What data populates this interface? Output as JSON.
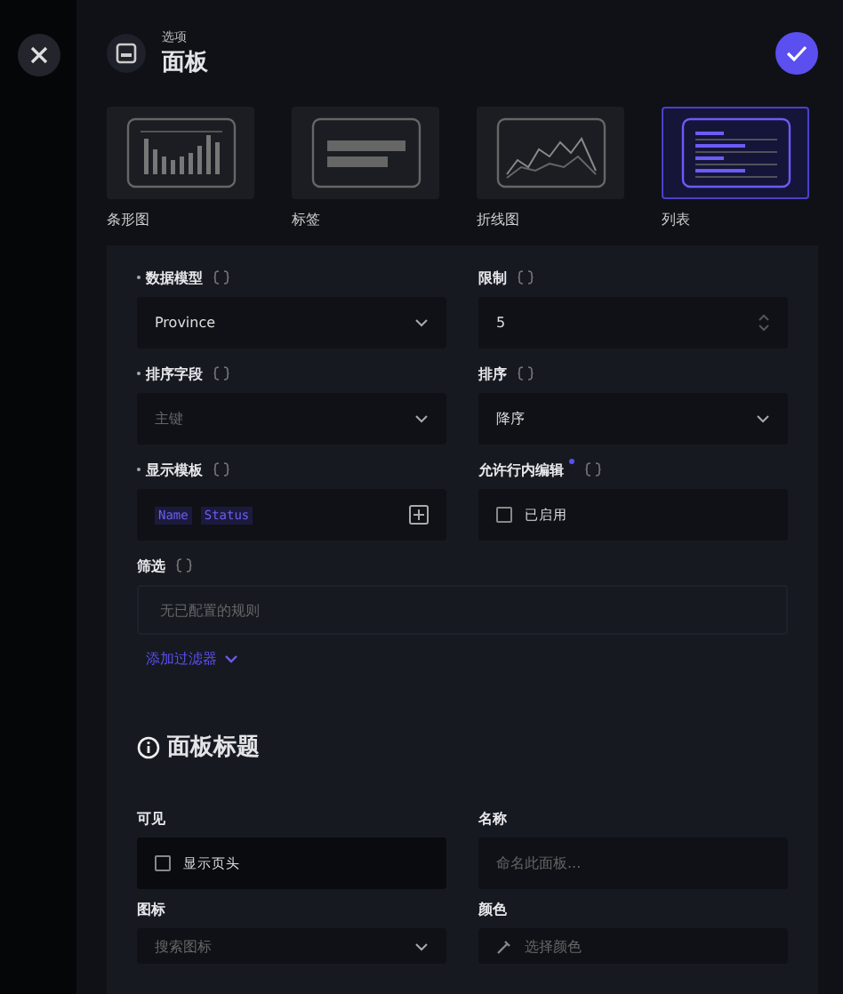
{
  "header": {
    "subtitle": "选项",
    "title": "面板"
  },
  "panel_types": [
    {
      "kind": "bar",
      "label": "条形图",
      "selected": false
    },
    {
      "kind": "tag",
      "label": "标签",
      "selected": false
    },
    {
      "kind": "line",
      "label": "折线图",
      "selected": false
    },
    {
      "kind": "list",
      "label": "列表",
      "selected": true
    }
  ],
  "fields": [
    {
      "label": "数据模型",
      "required": true,
      "marked": false,
      "kind": "select",
      "value": "Province"
    },
    {
      "label": "限制",
      "required": false,
      "marked": false,
      "kind": "number",
      "value": "5"
    },
    {
      "label": "排序字段",
      "required": true,
      "marked": false,
      "kind": "select",
      "placeholder": "主键"
    },
    {
      "label": "排序",
      "required": false,
      "marked": false,
      "kind": "select",
      "value": "降序"
    },
    {
      "label": "显示模板",
      "required": true,
      "marked": false,
      "kind": "template",
      "tokens": [
        "Name",
        "Status"
      ]
    },
    {
      "label": "允许行内编辑",
      "required": false,
      "marked": true,
      "kind": "checkbox",
      "option": "已启用",
      "checked": false
    }
  ],
  "filter": {
    "label": "筛选",
    "empty_text": "无已配置的规则",
    "add_link": "添加过滤器"
  },
  "title_section": {
    "heading": "面板标题",
    "fields": [
      {
        "label": "可见",
        "kind": "checkbox",
        "option": "显示页头",
        "checked": false
      },
      {
        "label": "名称",
        "kind": "text",
        "placeholder": "命名此面板..."
      },
      {
        "label": "图标",
        "kind": "select",
        "placeholder": "搜索图标"
      },
      {
        "label": "颜色",
        "kind": "color",
        "placeholder": "选择颜色"
      }
    ]
  }
}
